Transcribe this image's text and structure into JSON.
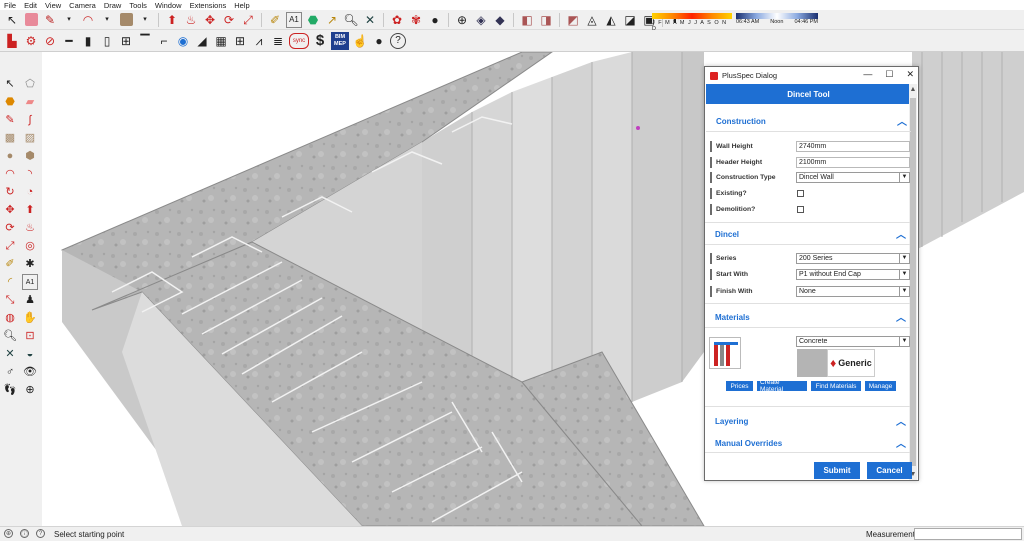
{
  "menu": [
    "File",
    "Edit",
    "View",
    "Camera",
    "Draw",
    "Tools",
    "Window",
    "Extensions",
    "Help"
  ],
  "shadow_months": "J F M A M J J A S O N D",
  "shadow_time_start": "06:43 AM",
  "shadow_time_noon": "Noon",
  "shadow_time_end": "04:46 PM",
  "toolbar2": {
    "bim_label": "BIM",
    "mep_label": "MEP",
    "sync_label": "sync"
  },
  "dialog": {
    "title": "PlusSpec Dialog",
    "header": "Dincel Tool",
    "construction": {
      "title": "Construction",
      "wall_height_label": "Wall Height",
      "wall_height_value": "2740mm",
      "header_height_label": "Header Height",
      "header_height_value": "2100mm",
      "construction_type_label": "Construction Type",
      "construction_type_value": "Dincel Wall",
      "existing_label": "Existing?",
      "demolition_label": "Demolition?"
    },
    "dincel": {
      "title": "Dincel",
      "series_label": "Series",
      "series_value": "200 Series",
      "start_with_label": "Start With",
      "start_with_value": "P1 without End Cap",
      "finish_with_label": "Finish With",
      "finish_with_value": "None"
    },
    "materials": {
      "title": "Materials",
      "material_value": "Concrete",
      "generic_label": "Generic",
      "prices_label": "Prices",
      "create_label": "Create Material",
      "find_label": "Find Materials",
      "manage_label": "Manage"
    },
    "layering_title": "Layering",
    "overrides_title": "Manual Overrides",
    "submit_label": "Submit",
    "cancel_label": "Cancel"
  },
  "status": {
    "hint": "Select starting point",
    "measurements_label": "Measurements",
    "measurements_value": ""
  },
  "colors": {
    "accent": "#1e6fd3",
    "concrete": "#b4b4b4",
    "panel_face": "#d2d2d2"
  }
}
